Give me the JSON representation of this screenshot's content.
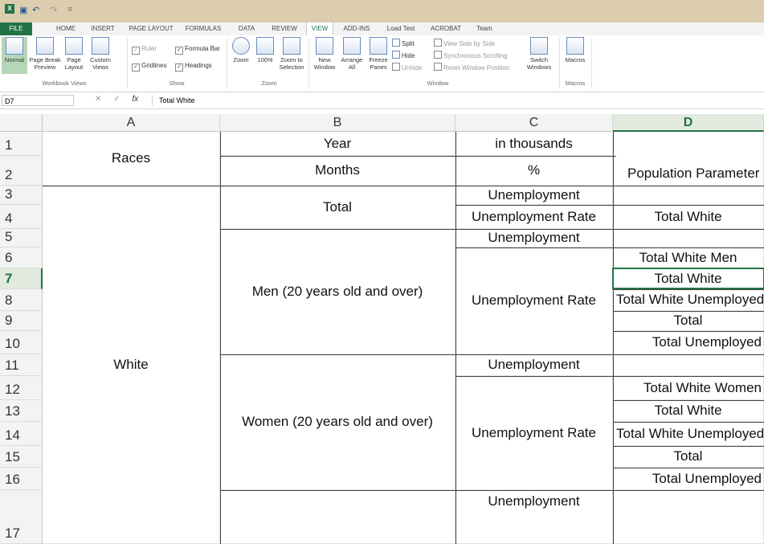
{
  "quick_access": {
    "app_icon": "excel-icon",
    "save_icon": "save-icon",
    "undo_icon": "undo-icon",
    "redo_icon": "redo-icon",
    "customize": "="
  },
  "tabs": [
    "FILE",
    "HOME",
    "INSERT",
    "PAGE LAYOUT",
    "FORMULAS",
    "DATA",
    "REVIEW",
    "VIEW",
    "ADD-INS",
    "Load Test",
    "ACROBAT",
    "Team"
  ],
  "active_tab": "VIEW",
  "ribbon": {
    "workbook_views": {
      "normal": "Normal",
      "page_break": "Page Break Preview",
      "page_layout": "Page Layout",
      "custom_views": "Custom Views",
      "group": "Workbook Views"
    },
    "show": {
      "ruler": "Ruler",
      "formula_bar": "Formula Bar",
      "gridlines": "Gridlines",
      "headings": "Headings",
      "group": "Show"
    },
    "zoom": {
      "zoom": "Zoom",
      "hundred": "100%",
      "zoom_sel": "Zoom to Selection",
      "group": "Zoom"
    },
    "window": {
      "new": "New Window",
      "arrange": "Arrange All",
      "freeze": "Freeze Panes",
      "split": "Split",
      "hide": "Hide",
      "unhide": "Unhide",
      "side_by_side": "View Side by Side",
      "sync_scroll": "Synchronous Scrolling",
      "reset_pos": "Reset Window Position",
      "switch": "Switch Windows",
      "group": "Window"
    },
    "macros": {
      "macros": "Macros",
      "group": "Macros"
    }
  },
  "formula_bar": {
    "name_box": "D7",
    "fx": "fx",
    "cancel": "✕",
    "enter": "✓",
    "content": "Total White"
  },
  "columns": [
    "A",
    "B",
    "C",
    "D"
  ],
  "selected_column": "D",
  "rows": [
    "1",
    "2",
    "3",
    "4",
    "5",
    "6",
    "7",
    "8",
    "9",
    "10",
    "11",
    "12",
    "13",
    "14",
    "15",
    "16",
    "17"
  ],
  "selected_row": "7",
  "cells": {
    "B1": "Year",
    "C1": "in thousands",
    "A1": "Races",
    "B2": "Months",
    "C2": "%",
    "D2": "Population Parameter",
    "B3": "Total",
    "C3": "Unemployment",
    "C4": "Unemployment Rate",
    "D4": "Total White",
    "C5": "Unemployment",
    "B5": "Men (20 years old and over)",
    "C6": "Unemployment Rate",
    "D6": "Total White Men",
    "D7": "Total White",
    "D8": "Total White Unemployed",
    "D9": "Total",
    "D10": "Total Unemployed",
    "C11": "Unemployment",
    "A11": "White",
    "B11": "Women (20 years old and over)",
    "C12": "Unemployment Rate",
    "D12": "Total White Women",
    "D13": "Total White",
    "D14": "Total White Unemployed",
    "D15": "Total",
    "D16": "Total Unemployed",
    "C17": "Unemployment"
  }
}
